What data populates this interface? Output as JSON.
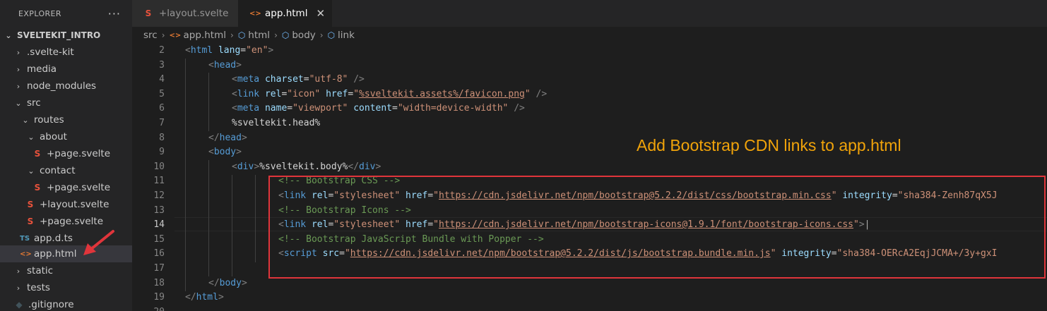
{
  "explorer": {
    "title": "EXPLORER",
    "more_actions": "···",
    "tree": [
      {
        "label": "SVELTEKIT_INTRO",
        "icon": "chevron-down-icon"
      },
      {
        "label": ".svelte-kit",
        "icon": "chevron-right-icon"
      },
      {
        "label": "media",
        "icon": "chevron-right-icon"
      },
      {
        "label": "node_modules",
        "icon": "chevron-right-icon"
      },
      {
        "label": "src",
        "icon": "chevron-down-icon"
      },
      {
        "label": "routes",
        "icon": "chevron-down-icon"
      },
      {
        "label": "about",
        "icon": "chevron-down-icon"
      },
      {
        "label": "+page.svelte",
        "icon": "svelte-file-icon"
      },
      {
        "label": "contact",
        "icon": "chevron-down-icon"
      },
      {
        "label": "+page.svelte",
        "icon": "svelte-file-icon"
      },
      {
        "label": "+layout.svelte",
        "icon": "svelte-file-icon"
      },
      {
        "label": "+page.svelte",
        "icon": "svelte-file-icon"
      },
      {
        "label": "app.d.ts",
        "icon": "typescript-file-icon",
        "badge": "TS"
      },
      {
        "label": "app.html",
        "icon": "html-file-icon",
        "badge": "<>",
        "selected": true
      },
      {
        "label": "static",
        "icon": "chevron-right-icon"
      },
      {
        "label": "tests",
        "icon": "chevron-right-icon"
      },
      {
        "label": ".gitignore",
        "icon": "git-file-icon"
      }
    ]
  },
  "tabs": [
    {
      "label": "+layout.svelte",
      "icon": "svelte-file-icon",
      "active": false
    },
    {
      "label": "app.html",
      "icon": "html-file-icon",
      "active": true,
      "close": "✕"
    }
  ],
  "breadcrumb": {
    "items": [
      {
        "label": "src"
      },
      {
        "label": "app.html",
        "badge": "<>"
      },
      {
        "label": "html",
        "icon": "symbol-field-icon"
      },
      {
        "label": "body",
        "icon": "symbol-field-icon"
      },
      {
        "label": "link",
        "icon": "symbol-field-icon"
      }
    ]
  },
  "editor": {
    "active_line": 14,
    "lines": [
      {
        "n": "2"
      },
      {
        "n": "3"
      },
      {
        "n": "4"
      },
      {
        "n": "5"
      },
      {
        "n": "6"
      },
      {
        "n": "7"
      },
      {
        "n": "8"
      },
      {
        "n": "9"
      },
      {
        "n": "10"
      },
      {
        "n": "11"
      },
      {
        "n": "12"
      },
      {
        "n": "13"
      },
      {
        "n": "14"
      },
      {
        "n": "15"
      },
      {
        "n": "16"
      },
      {
        "n": "17"
      },
      {
        "n": "18"
      },
      {
        "n": "19"
      },
      {
        "n": "20"
      }
    ],
    "code": {
      "l2_tag": "html",
      "l2_attr": "lang",
      "l2_val": "\"en\"",
      "l3_tag": "head",
      "l4_tag": "meta",
      "l4_attr": "charset",
      "l4_val": "\"utf-8\"",
      "l5_tag": "link",
      "l5_attr1": "rel",
      "l5_val1": "\"icon\"",
      "l5_attr2": "href",
      "l5_q1": "\"",
      "l5_url": "%sveltekit.assets%/favicon.png",
      "l5_q2": "\"",
      "l6_tag": "meta",
      "l6_attr1": "name",
      "l6_val1": "\"viewport\"",
      "l6_attr2": "content",
      "l6_val2": "\"width=device-width\"",
      "l7_text": "%sveltekit.head%",
      "l8_tag": "head",
      "l9_tag": "body",
      "l10_tag": "div",
      "l10_text": "%sveltekit.body%",
      "l10_close": "div",
      "l11_comment": "<!-- Bootstrap CSS -->",
      "l12_tag": "link",
      "l12_attr1": "rel",
      "l12_val1": "\"stylesheet\"",
      "l12_attr2": "href",
      "l12_url": "https://cdn.jsdelivr.net/npm/bootstrap@5.2.2/dist/css/bootstrap.min.css",
      "l12_attr3": "integrity",
      "l12_val3": "\"sha384-Zenh87qX5J",
      "l13_comment": "<!-- Bootstrap Icons -->",
      "l14_tag": "link",
      "l14_attr1": "rel",
      "l14_val1": "\"stylesheet\"",
      "l14_attr2": "href",
      "l14_url": "https://cdn.jsdelivr.net/npm/bootstrap-icons@1.9.1/font/bootstrap-icons.css",
      "l15_comment": "<!-- Bootstrap JavaScript Bundle with Popper -->",
      "l16_tag": "script",
      "l16_attr1": "src",
      "l16_url": "https://cdn.jsdelivr.net/npm/bootstrap@5.2.2/dist/js/bootstrap.bundle.min.js",
      "l16_attr2": "integrity",
      "l16_val2": "\"sha384-OERcA2EqjJCMA+/3y+gxI",
      "l18_tag": "body",
      "l19_tag": "html"
    }
  },
  "annotation": {
    "text": "Add Bootstrap CDN links to app.html",
    "color": "#f0a30a"
  },
  "colors": {
    "highlight_box": "#e0353b",
    "arrow": "#e0353b"
  }
}
